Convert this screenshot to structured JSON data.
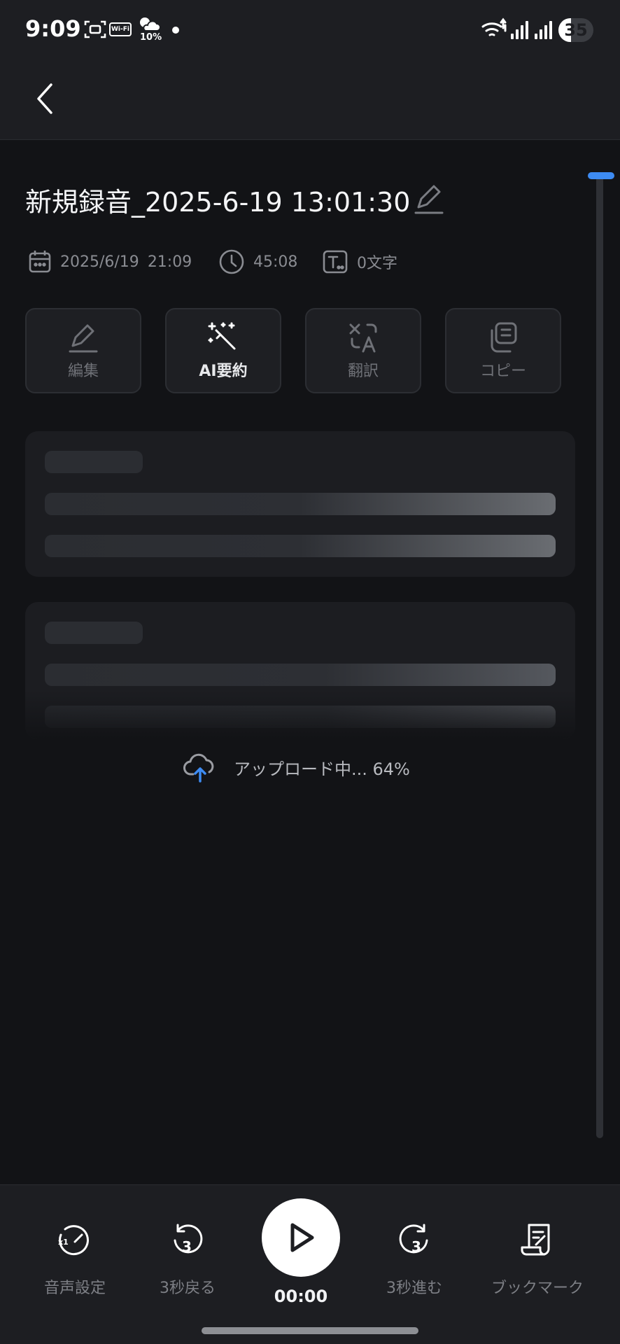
{
  "status_bar": {
    "time": "9:09",
    "wifi_tag": "Wi-Fi",
    "weather_percent": "10%",
    "battery_level": "35",
    "battery_fraction": 0.35
  },
  "recording": {
    "title": "新規録音_2025-6-19 13:01:30",
    "date": "2025/6/19",
    "time": "21:09",
    "duration": "45:08",
    "char_count": "0文字"
  },
  "actions": [
    {
      "label": "編集",
      "icon": "pencil-icon"
    },
    {
      "label": "AI要約",
      "icon": "magic-wand-icon"
    },
    {
      "label": "翻訳",
      "icon": "translate-icon"
    },
    {
      "label": "コピー",
      "icon": "copy-icon"
    }
  ],
  "upload": {
    "text": "アップロード中... 64%",
    "progress_percent": 64
  },
  "player": {
    "audio_settings_label": "音声設定",
    "speed_badge": "x1",
    "rewind_label": "3秒戻る",
    "rewind_seconds": "3",
    "current_time": "00:00",
    "forward_label": "3秒進む",
    "forward_seconds": "3",
    "bookmark_label": "ブックマーク"
  },
  "colors": {
    "accent": "#3D8BF2",
    "background": "#121316",
    "surface": "#1D1E22"
  }
}
